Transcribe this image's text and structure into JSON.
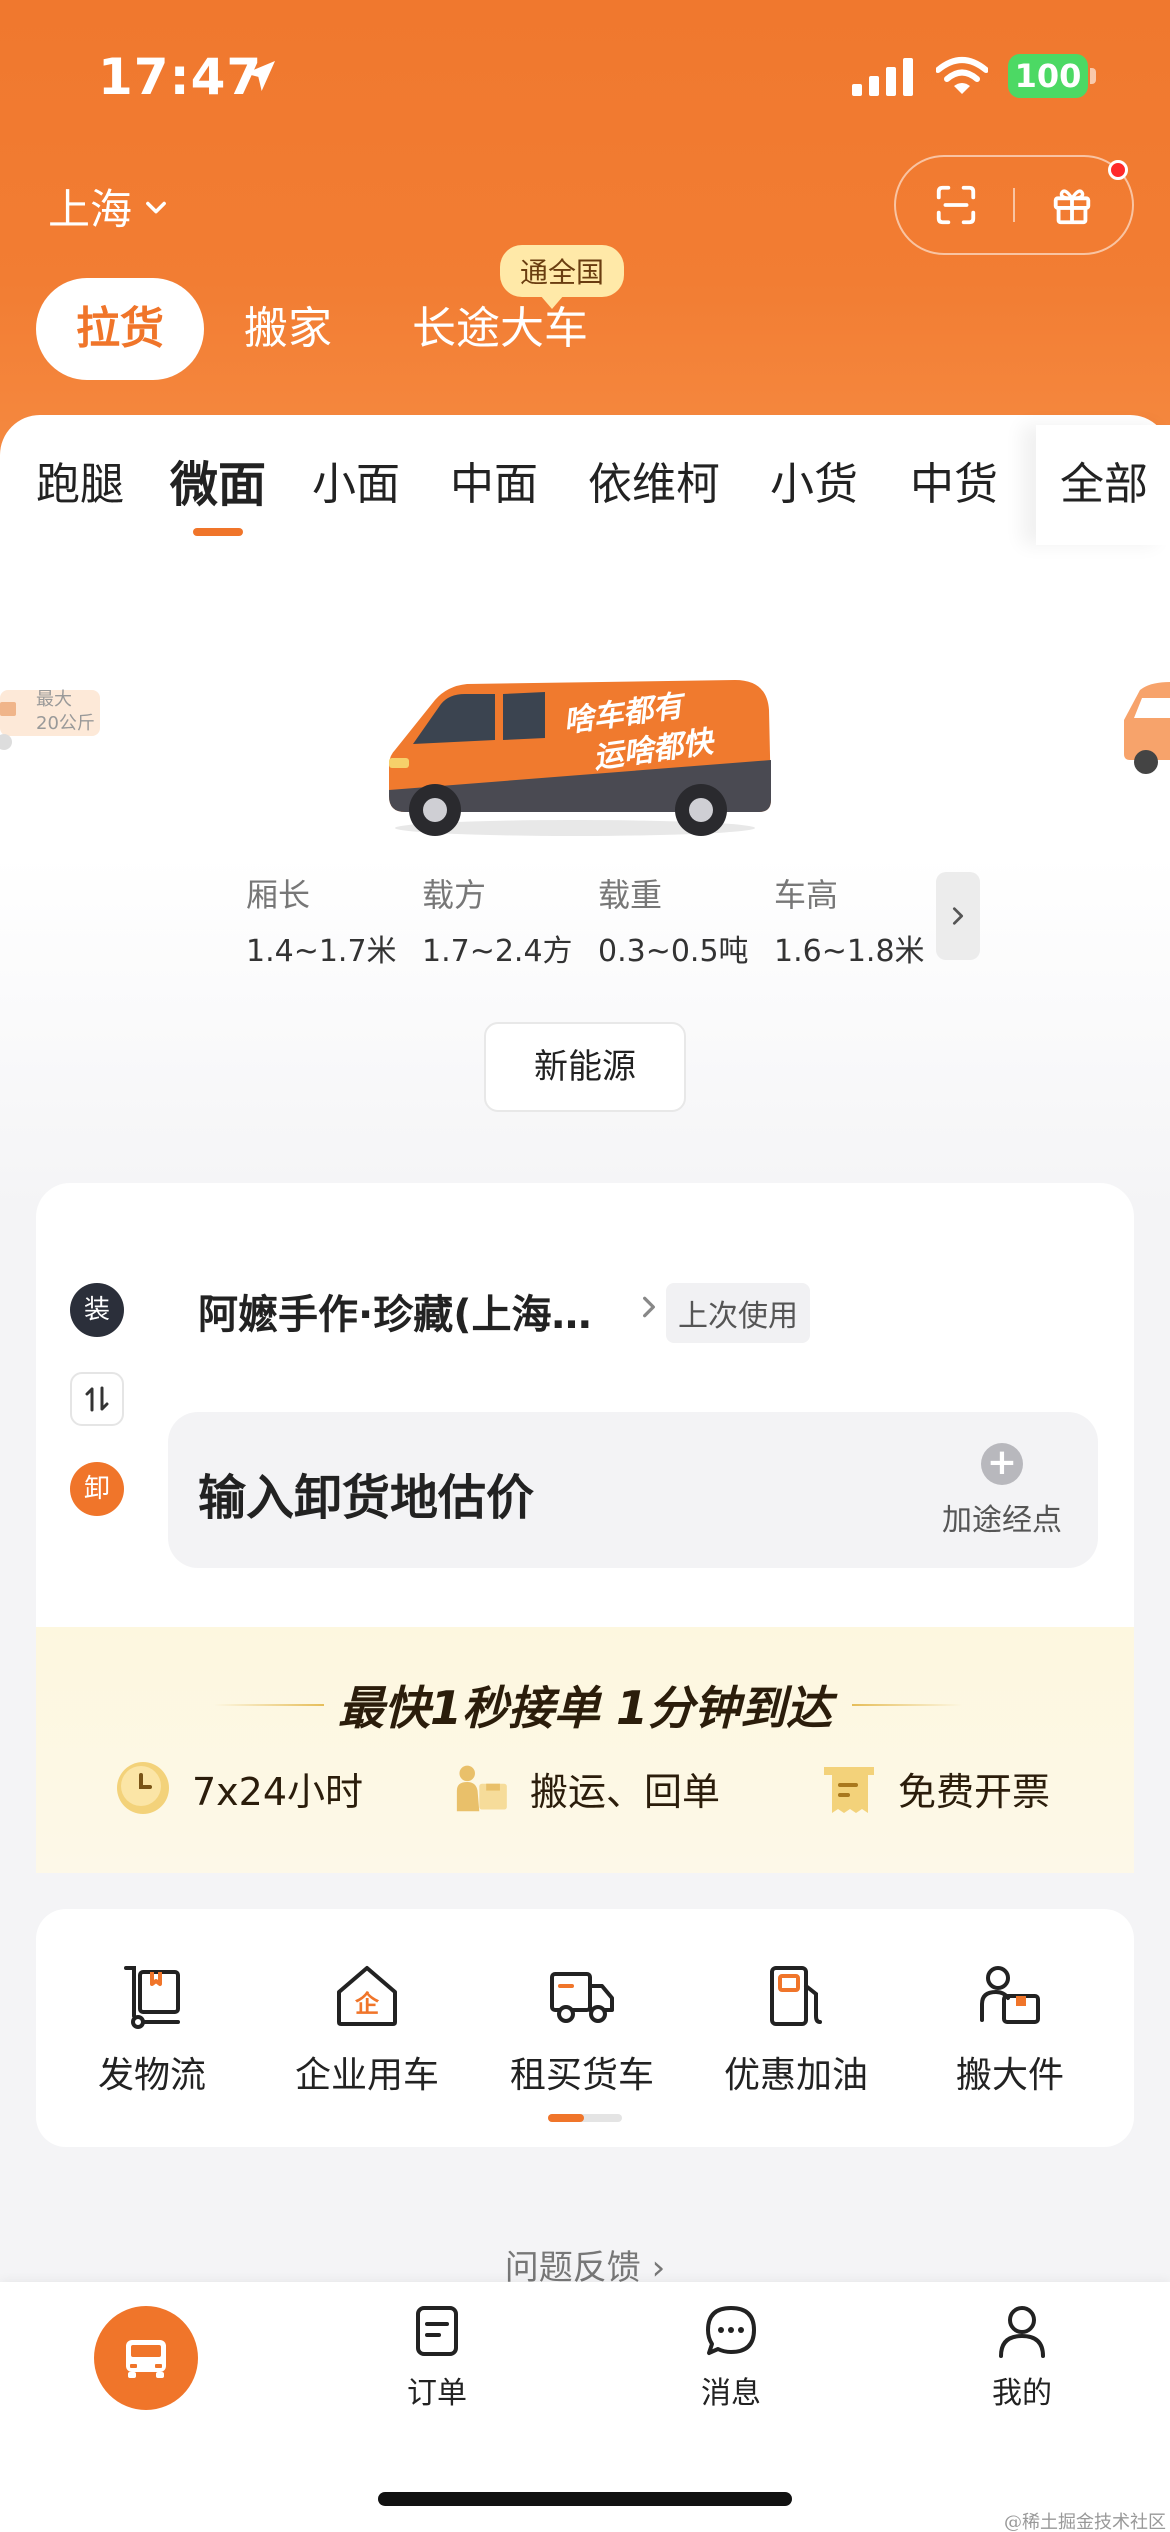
{
  "status_bar": {
    "time": "17:47",
    "battery": "100"
  },
  "header": {
    "city": "上海"
  },
  "mode_tabs": [
    {
      "label": "拉货"
    },
    {
      "label": "搬家"
    },
    {
      "label": "长途大车"
    }
  ],
  "mode_badge": "通全国",
  "vehicle_tabs": [
    {
      "label": "跑腿"
    },
    {
      "label": "微面"
    },
    {
      "label": "小面"
    },
    {
      "label": "中面"
    },
    {
      "label": "依维柯"
    },
    {
      "label": "小货"
    },
    {
      "label": "中货"
    }
  ],
  "vehicle_all": "全部",
  "vehicle": {
    "van_slogan_1": "啥车都有",
    "van_slogan_2": "运啥都快",
    "left_tag_1": "最大",
    "left_tag_2": "20公斤",
    "specs": [
      {
        "label": "厢长",
        "value": "1.4~1.7米"
      },
      {
        "label": "载方",
        "value": "1.7~2.4方"
      },
      {
        "label": "载重",
        "value": "0.3~0.5吨"
      },
      {
        "label": "车高",
        "value": "1.6~1.8米"
      }
    ],
    "energy_button": "新能源"
  },
  "address": {
    "load_badge": "装",
    "unload_badge": "卸",
    "load_address": "阿嬷手作·珍藏(上海…",
    "last_used": "上次使用",
    "unload_placeholder": "输入卸货地估价",
    "add_stop": "加途经点"
  },
  "promo": {
    "title": "最快1秒接单 1分钟到达",
    "items": [
      {
        "label": "7x24小时",
        "icon": "clock-icon"
      },
      {
        "label": "搬运、回单",
        "icon": "porter-icon"
      },
      {
        "label": "免费开票",
        "icon": "invoice-icon"
      }
    ]
  },
  "services": [
    {
      "label": "发物流",
      "icon": "logistics-icon"
    },
    {
      "label": "企业用车",
      "icon": "enterprise-icon"
    },
    {
      "label": "租买货车",
      "icon": "truck-icon"
    },
    {
      "label": "优惠加油",
      "icon": "fuel-icon"
    },
    {
      "label": "搬大件",
      "icon": "bulky-icon"
    }
  ],
  "feedback": "问题反馈",
  "bottom_nav": [
    {
      "label": "订单"
    },
    {
      "label": "消息"
    },
    {
      "label": "我的"
    }
  ],
  "watermark": "@稀土掘金技术社区",
  "colors": {
    "brand": "#f0752a",
    "dark": "#2b2f3a",
    "promo_bg": "#fdf7df"
  }
}
